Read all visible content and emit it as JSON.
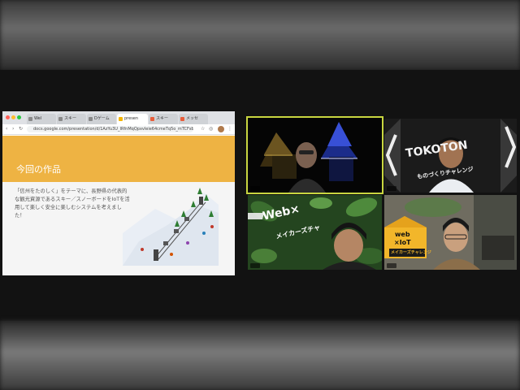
{
  "browser": {
    "tabs": [
      {
        "label": "Wel"
      },
      {
        "label": "スキー"
      },
      {
        "label": "Dゲーム"
      },
      {
        "label": "presen"
      },
      {
        "label": "スキー"
      },
      {
        "label": "メッセ"
      }
    ],
    "url": "docs.google.com/presentation/d/1AzYu3U_IRfnMqQpxvleie64cmeTq5o_mTCFsBeGcD..."
  },
  "slide": {
    "title": "今回の作品",
    "body": "「信州をたのしく」をテーマに、長野県の代表的な観光資源であるスキー／スノーボードをIoTを活用して楽しく安全に楽しむシステムを考えました！"
  },
  "participants": [
    {
      "id": "presenter",
      "background": "castle-night",
      "active_speaker": true
    },
    {
      "id": "student-1",
      "background": "tokoton-sign",
      "banner_text": "TOKOTON",
      "sub_text": "ものづくりチャレンジ"
    },
    {
      "id": "student-2",
      "background": "leaves",
      "banner_text": "Web×",
      "sub_text": "メイカーズチャ"
    },
    {
      "id": "student-3",
      "background": "room",
      "badge_line1": "web",
      "badge_line2": "×IoT",
      "badge_line3": "メイカーズチャレンジ"
    }
  ],
  "colors": {
    "slide_header": "#eeb343",
    "active_speaker_border": "#c8d640",
    "stage_background": "#121212"
  }
}
